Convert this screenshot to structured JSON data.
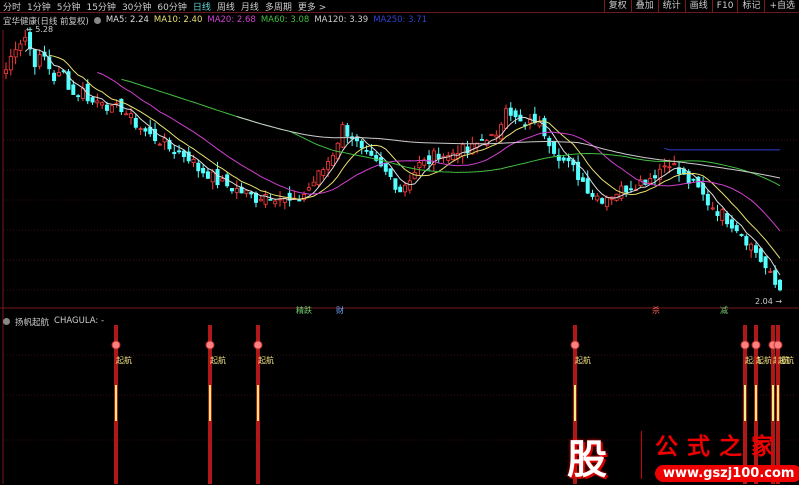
{
  "toolbar": {
    "periods": [
      "分时",
      "1分钟",
      "5分钟",
      "15分钟",
      "30分钟",
      "60分钟",
      "日线",
      "周线",
      "月线",
      "多周期",
      "更多 >"
    ],
    "active": "日线",
    "right_buttons": [
      "复权",
      "叠加",
      "统计",
      "画线",
      "F10",
      "标记",
      "+自选"
    ]
  },
  "main_chart": {
    "title": "宜华健康(日线 前复权)",
    "ma": [
      {
        "label": "MA5: 2.24",
        "color": "#dddddd"
      },
      {
        "label": "MA10: 2.40",
        "color": "#e8e070"
      },
      {
        "label": "MA20: 2.68",
        "color": "#d040d0"
      },
      {
        "label": "MA60: 3.08",
        "color": "#40c040"
      },
      {
        "label": "MA120: 3.39",
        "color": "#cccccc"
      },
      {
        "label": "MA250: 3.71",
        "color": "#3040d0"
      }
    ],
    "high_label": "5.28",
    "low_label": "2.04",
    "price_max": 5.28,
    "price_min": 2.04,
    "tags": [
      {
        "text": "精跌",
        "color": "#6fcf6f"
      },
      {
        "text": "财",
        "color": "#6fa8ff"
      },
      {
        "text": "杀",
        "color": "#ff6060"
      },
      {
        "text": "减",
        "color": "#6fcf6f"
      }
    ],
    "closes": [
      4.8,
      5.1,
      5.2,
      4.9,
      4.95,
      4.7,
      4.75,
      4.5,
      4.55,
      4.4,
      4.45,
      4.3,
      4.35,
      4.2,
      4.1,
      4.0,
      3.95,
      3.85,
      3.8,
      3.75,
      3.6,
      3.55,
      3.45,
      3.4,
      3.35,
      3.3,
      3.25,
      3.3,
      3.28,
      3.22,
      3.18,
      3.3,
      3.45,
      3.6,
      3.8,
      4.1,
      4.0,
      3.8,
      3.7,
      3.6,
      3.5,
      3.35,
      3.5,
      3.65,
      3.7,
      3.8,
      3.75,
      3.85,
      3.8,
      3.9,
      4.0,
      3.95,
      4.4,
      4.2,
      4.1,
      4.2,
      4.05,
      3.85,
      3.7,
      3.6,
      3.45,
      3.3,
      3.25,
      3.3,
      3.35,
      3.4,
      3.45,
      3.5,
      3.6,
      3.7,
      3.55,
      3.45,
      3.35,
      3.2,
      3.1,
      3.0,
      2.9,
      2.75,
      2.6,
      2.4,
      2.2,
      2.1
    ]
  },
  "indicator": {
    "title": "扬帆起航",
    "value": "CHAGULA: -",
    "signal_label": "起航",
    "signals": 8
  },
  "watermark": {
    "logo_char": "股",
    "name": "公式之家",
    "url": "www.gszj100.com"
  }
}
